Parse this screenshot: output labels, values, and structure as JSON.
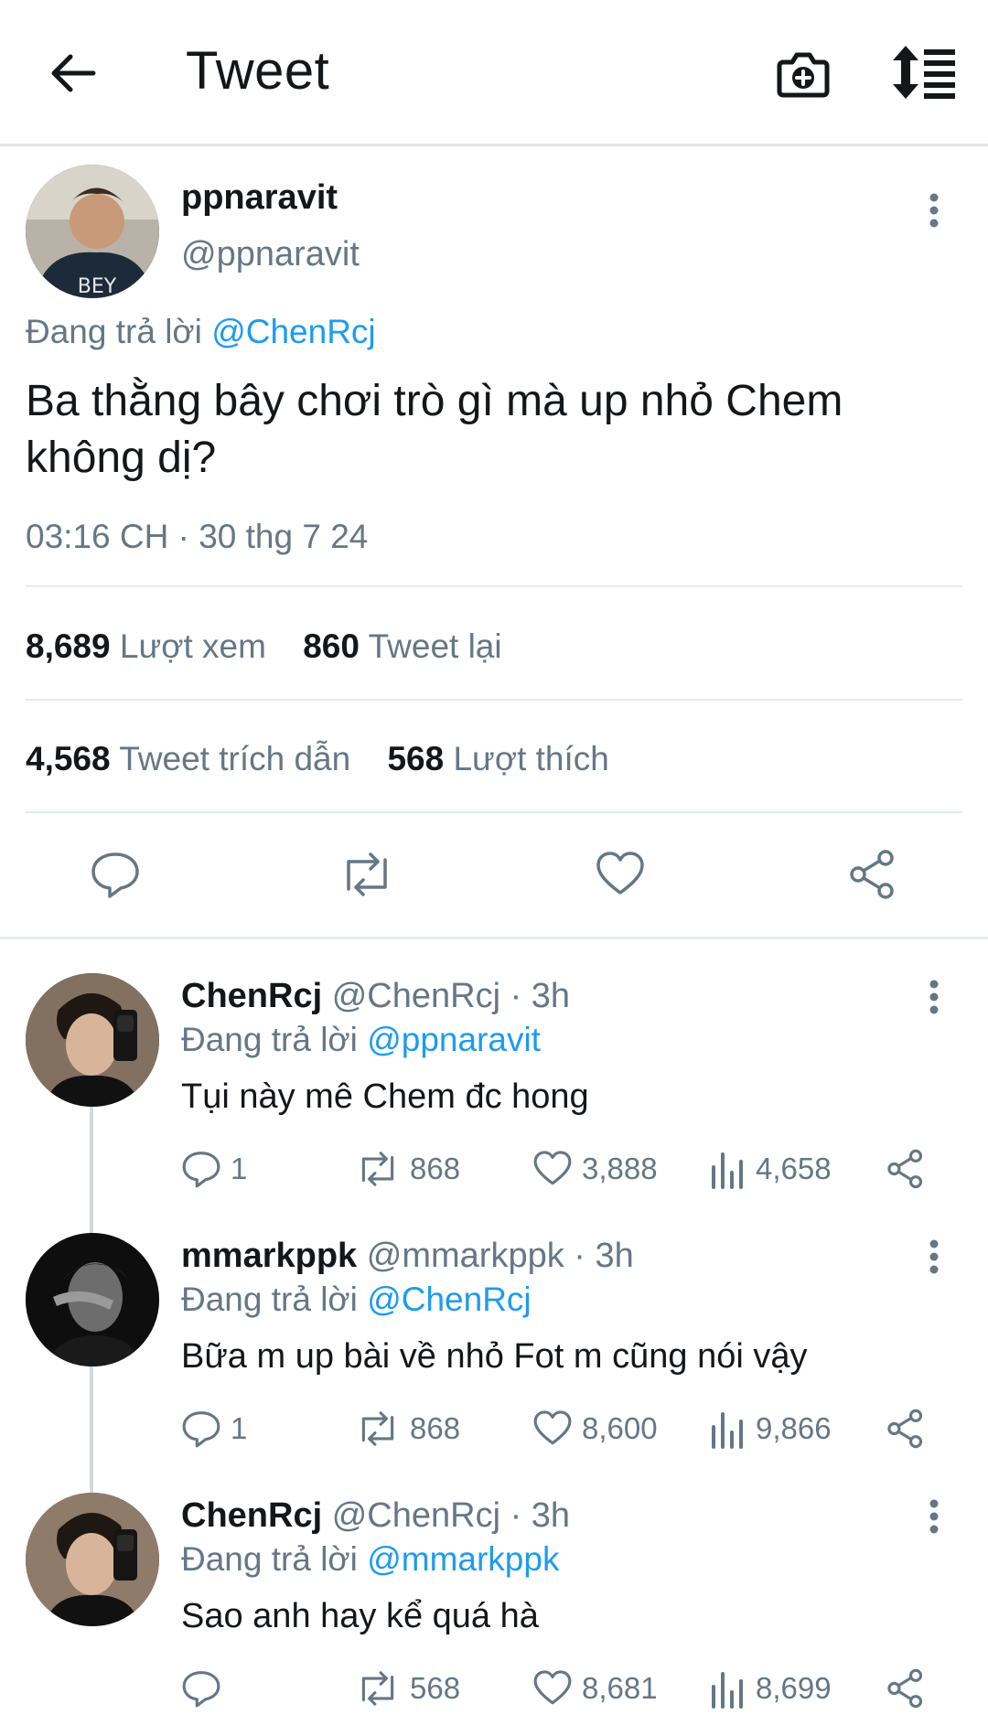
{
  "header": {
    "title": "Tweet",
    "back_icon": "back-arrow-icon",
    "camera_icon": "camera-plus-icon",
    "sort_icon": "sort-list-icon"
  },
  "tweet": {
    "display_name": "ppnaravit",
    "handle": "@ppnaravit",
    "replying_prefix": "Đang trả lời",
    "replying_to": "@ChenRcj",
    "text": "Ba thằng bây chơi trò gì mà up nhỏ Chem không dị?",
    "timestamp": "03:16 CH · 30 thg 7 24",
    "stats": {
      "views_count": "8,689",
      "views_label": "Lượt xem",
      "retweets_count": "860",
      "retweets_label": "Tweet lại",
      "quotes_count": "4,568",
      "quotes_label": "Tweet trích dẫn",
      "likes_count": "568",
      "likes_label": "Lượt thích"
    }
  },
  "replies": [
    {
      "display_name": "ChenRcj",
      "handle": "@ChenRcj",
      "time": " · 3h",
      "replying_prefix": "Đang trả lời",
      "replying_to": "@ppnaravit",
      "text": "Tụi này mê Chem đc hong",
      "reply_count": "1",
      "retweet_count": "868",
      "like_count": "3,888",
      "view_count": "4,658"
    },
    {
      "display_name": "mmarkppk",
      "handle": "@mmarkppk",
      "time": " · 3h",
      "replying_prefix": "Đang trả lời",
      "replying_to": "@ChenRcj",
      "text": "Bữa m up bài về nhỏ Fot m cũng nói vậy",
      "reply_count": "1",
      "retweet_count": "868",
      "like_count": "8,600",
      "view_count": "9,866"
    },
    {
      "display_name": "ChenRcj",
      "handle": "@ChenRcj",
      "time": " · 3h",
      "replying_prefix": "Đang trả lời",
      "replying_to": "@mmarkppk",
      "text": "Sao anh hay kể quá hà",
      "reply_count": "",
      "retweet_count": "568",
      "like_count": "8,681",
      "view_count": "8,699"
    }
  ],
  "colors": {
    "link": "#1d9bf0",
    "muted": "#657786",
    "text": "#14171a",
    "divider": "#e6ecf0"
  }
}
